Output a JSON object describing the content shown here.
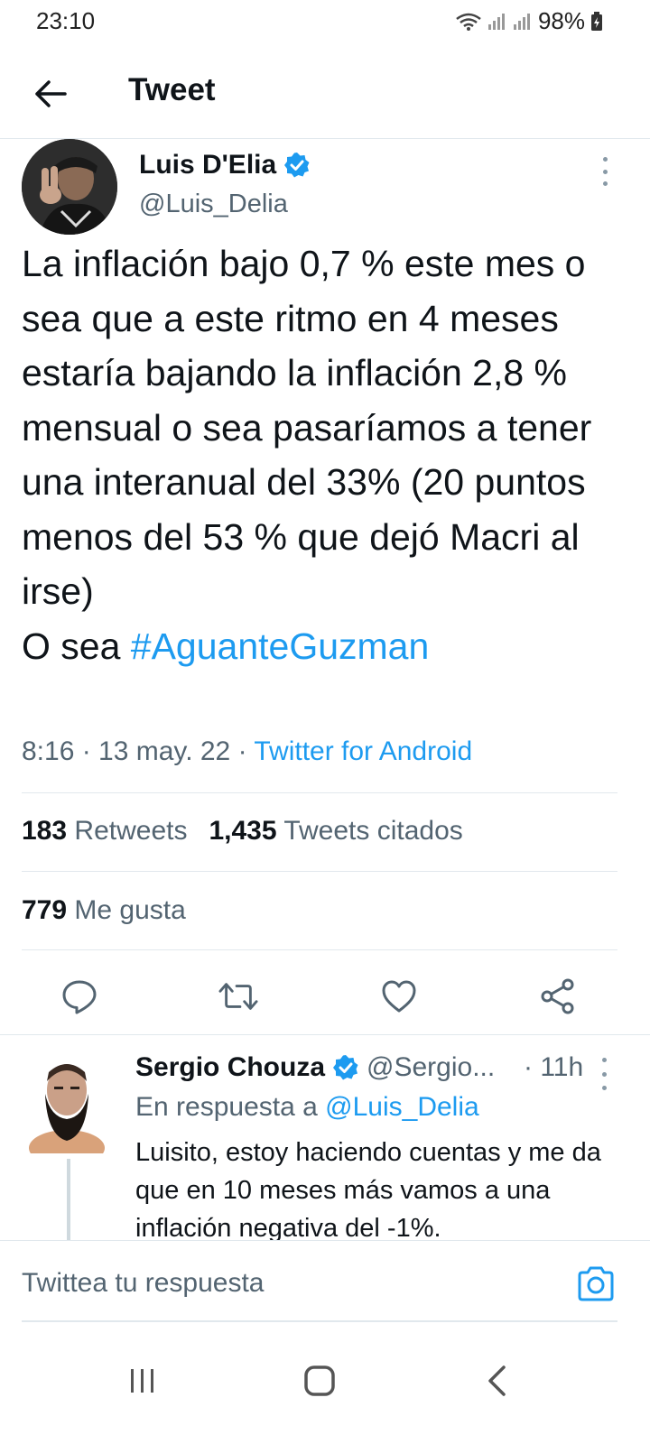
{
  "status_bar": {
    "time": "23:10",
    "battery": "98%"
  },
  "header": {
    "title": "Tweet"
  },
  "tweet": {
    "author_name": "Luis D'Elia",
    "author_handle": "@Luis_Delia",
    "text_main": "La inflación bajo 0,7 % este mes o sea que a este ritmo en 4 meses estaría bajando la inflación 2,8 % mensual o sea pasaríamos a tener una interanual del 33% (20 puntos menos del 53 % que dejó Macri al irse)\nO sea ",
    "hashtag": "#AguanteGuzman",
    "timestamp": "8:16 · 13 may. 22 · ",
    "source": "Twitter for Android",
    "retweets_count": "183",
    "retweets_label": "Retweets",
    "quotes_count": "1,435",
    "quotes_label": "Tweets citados",
    "likes_count": "779",
    "likes_label": "Me gusta"
  },
  "actions": {
    "reply_icon": "comment-icon",
    "retweet_icon": "retweet-icon",
    "like_icon": "heart-icon",
    "share_icon": "share-icon"
  },
  "reply": {
    "author_name": "Sergio Chouza",
    "author_handle": "@Sergio...",
    "time": "· 11h",
    "replying_to_label": "En respuesta a ",
    "replying_to_handle": "@Luis_Delia",
    "text": "Luisito, estoy haciendo cuentas y me da que en 10 meses más vamos a una inflación negativa del -1%."
  },
  "compose": {
    "placeholder": "Twittea tu respuesta"
  },
  "colors": {
    "accent": "#1d9bf0",
    "text": "#0f1419",
    "secondary": "#536471",
    "divider": "#e1e8ed"
  }
}
